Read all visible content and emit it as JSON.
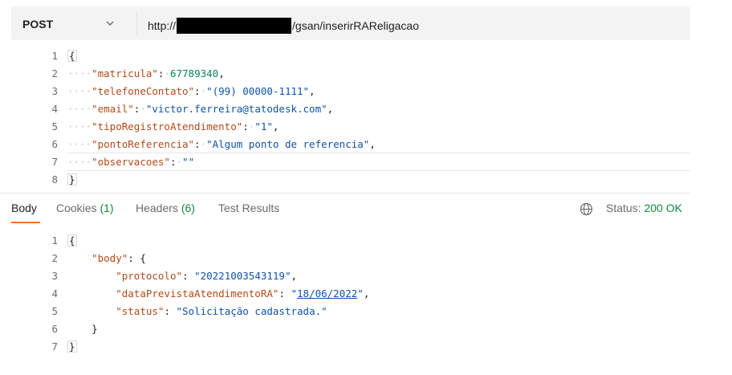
{
  "request": {
    "method": "POST",
    "url_prefix": "http://",
    "url_suffix": "/gsan/inserirRAReligacao"
  },
  "request_body": {
    "lines": [
      {
        "n": "1"
      },
      {
        "n": "2",
        "key": "\"matricula\"",
        "value": "67789340"
      },
      {
        "n": "3",
        "key": "\"telefoneContato\"",
        "value": "\"(99) 00000-1111\""
      },
      {
        "n": "4",
        "key": "\"email\"",
        "value": "\"victor.ferreira@tatodesk.com\""
      },
      {
        "n": "5",
        "key": "\"tipoRegistroAtendimento\"",
        "value": "\"1\""
      },
      {
        "n": "6",
        "key": "\"pontoReferencia\"",
        "value": "\"Algum ponto de referencia\""
      },
      {
        "n": "7",
        "key": "\"observacoes\"",
        "value": "\"\""
      },
      {
        "n": "8"
      }
    ],
    "open_brace": "{",
    "close_brace": "}"
  },
  "response_tabs": [
    {
      "label": "Body",
      "count": ""
    },
    {
      "label": "Cookies",
      "count": "(1)"
    },
    {
      "label": "Headers",
      "count": "(6)"
    },
    {
      "label": "Test Results",
      "count": ""
    }
  ],
  "status": {
    "label": "Status:",
    "value": "200 OK"
  },
  "response_body": {
    "line_numbers": [
      "1",
      "2",
      "3",
      "4",
      "5",
      "6",
      "7"
    ],
    "open_brace": "{",
    "close_brace": "}",
    "body_key": "\"body\"",
    "body_open": "{",
    "body_close": "}",
    "protocolo_key": "\"protocolo\"",
    "protocolo_value": "\"20221003543119\"",
    "data_key": "\"dataPrevistaAtendimentoRA\"",
    "data_value_q1": "\"",
    "data_value_date": "18/06/2022",
    "data_value_q2": "\"",
    "status_key": "\"status\"",
    "status_value": "\"Solicitação cadastrada.\""
  },
  "colors": {
    "accent": "#ff6c37",
    "success": "#0d8a3a",
    "key": "#b24a18",
    "string": "#0f52a8"
  },
  "icons": {
    "method_dropdown": "chevron-down-icon",
    "network": "globe-icon"
  }
}
